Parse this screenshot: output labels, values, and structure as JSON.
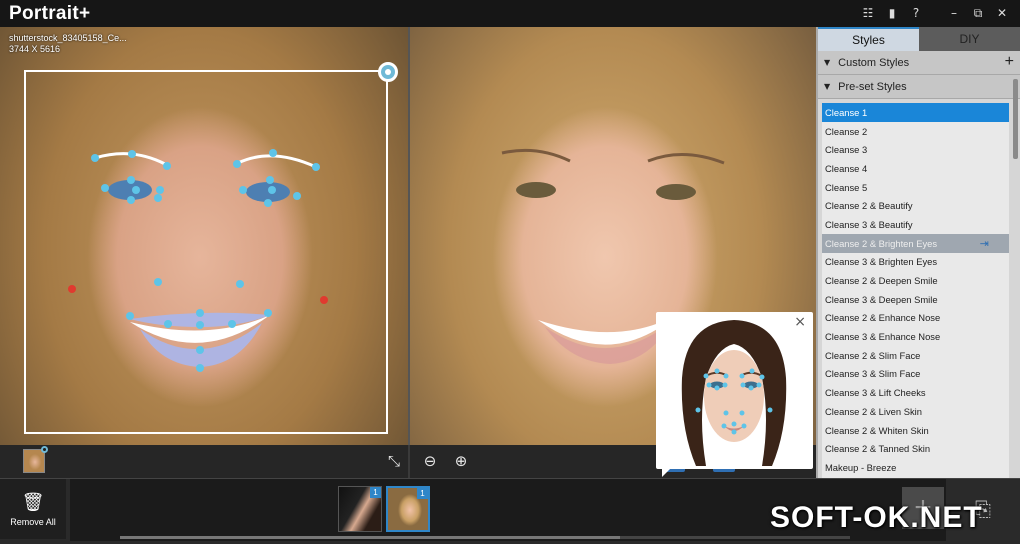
{
  "app": {
    "title": "Portrait+"
  },
  "window_controls": {
    "menu": "☷",
    "chat": "▮",
    "help": "?",
    "minimize": "–",
    "restore": "⧉",
    "close": "✕"
  },
  "canvas": {
    "file_name": "shutterstock_83405158_Ce...",
    "dimensions": "3744 X 5616"
  },
  "toolbar": {
    "collapse": "⤡",
    "zoom_out": "⊖",
    "zoom_in": "⊕",
    "help": "?",
    "refresh": "⟳",
    "face": "☺",
    "bandage": "✚",
    "brush": "✎"
  },
  "guide": {
    "close": "×"
  },
  "panel": {
    "tabs": [
      "Styles",
      "DIY"
    ],
    "custom_styles": "Custom Styles",
    "custom_add": "+",
    "preset_styles": "Pre-set Styles",
    "items": [
      "Cleanse 1",
      "Cleanse 2",
      "Cleanse 3",
      "Cleanse 4",
      "Cleanse 5",
      "Cleanse 2 & Beautify",
      "Cleanse 3 & Beautify",
      "Cleanse 2 & Brighten Eyes",
      "Cleanse 3 & Brighten Eyes",
      "Cleanse 2 & Deepen Smile",
      "Cleanse 3 & Deepen Smile",
      "Cleanse 2 & Enhance Nose",
      "Cleanse 3 & Enhance Nose",
      "Cleanse 2 & Slim Face",
      "Cleanse 3 & Slim Face",
      "Cleanse 3 & Lift Cheeks",
      "Cleanse 2 & Liven Skin",
      "Cleanse 2 & Whiten Skin",
      "Cleanse 2 & Tanned Skin",
      "Makeup - Breeze"
    ],
    "selected_index": 0,
    "hover_index": 7,
    "apply_icon": "⇥"
  },
  "filmstrip": {
    "remove_all": "Remove All",
    "trash": "🗑",
    "badges": [
      "1",
      "1"
    ],
    "add": "+",
    "export": "⎘"
  },
  "watermark": "SOFT-OK.NET",
  "colors": {
    "accent": "#1a86d8",
    "landmark": "#5ec4e8",
    "landmark_warn": "#e03a2f"
  }
}
